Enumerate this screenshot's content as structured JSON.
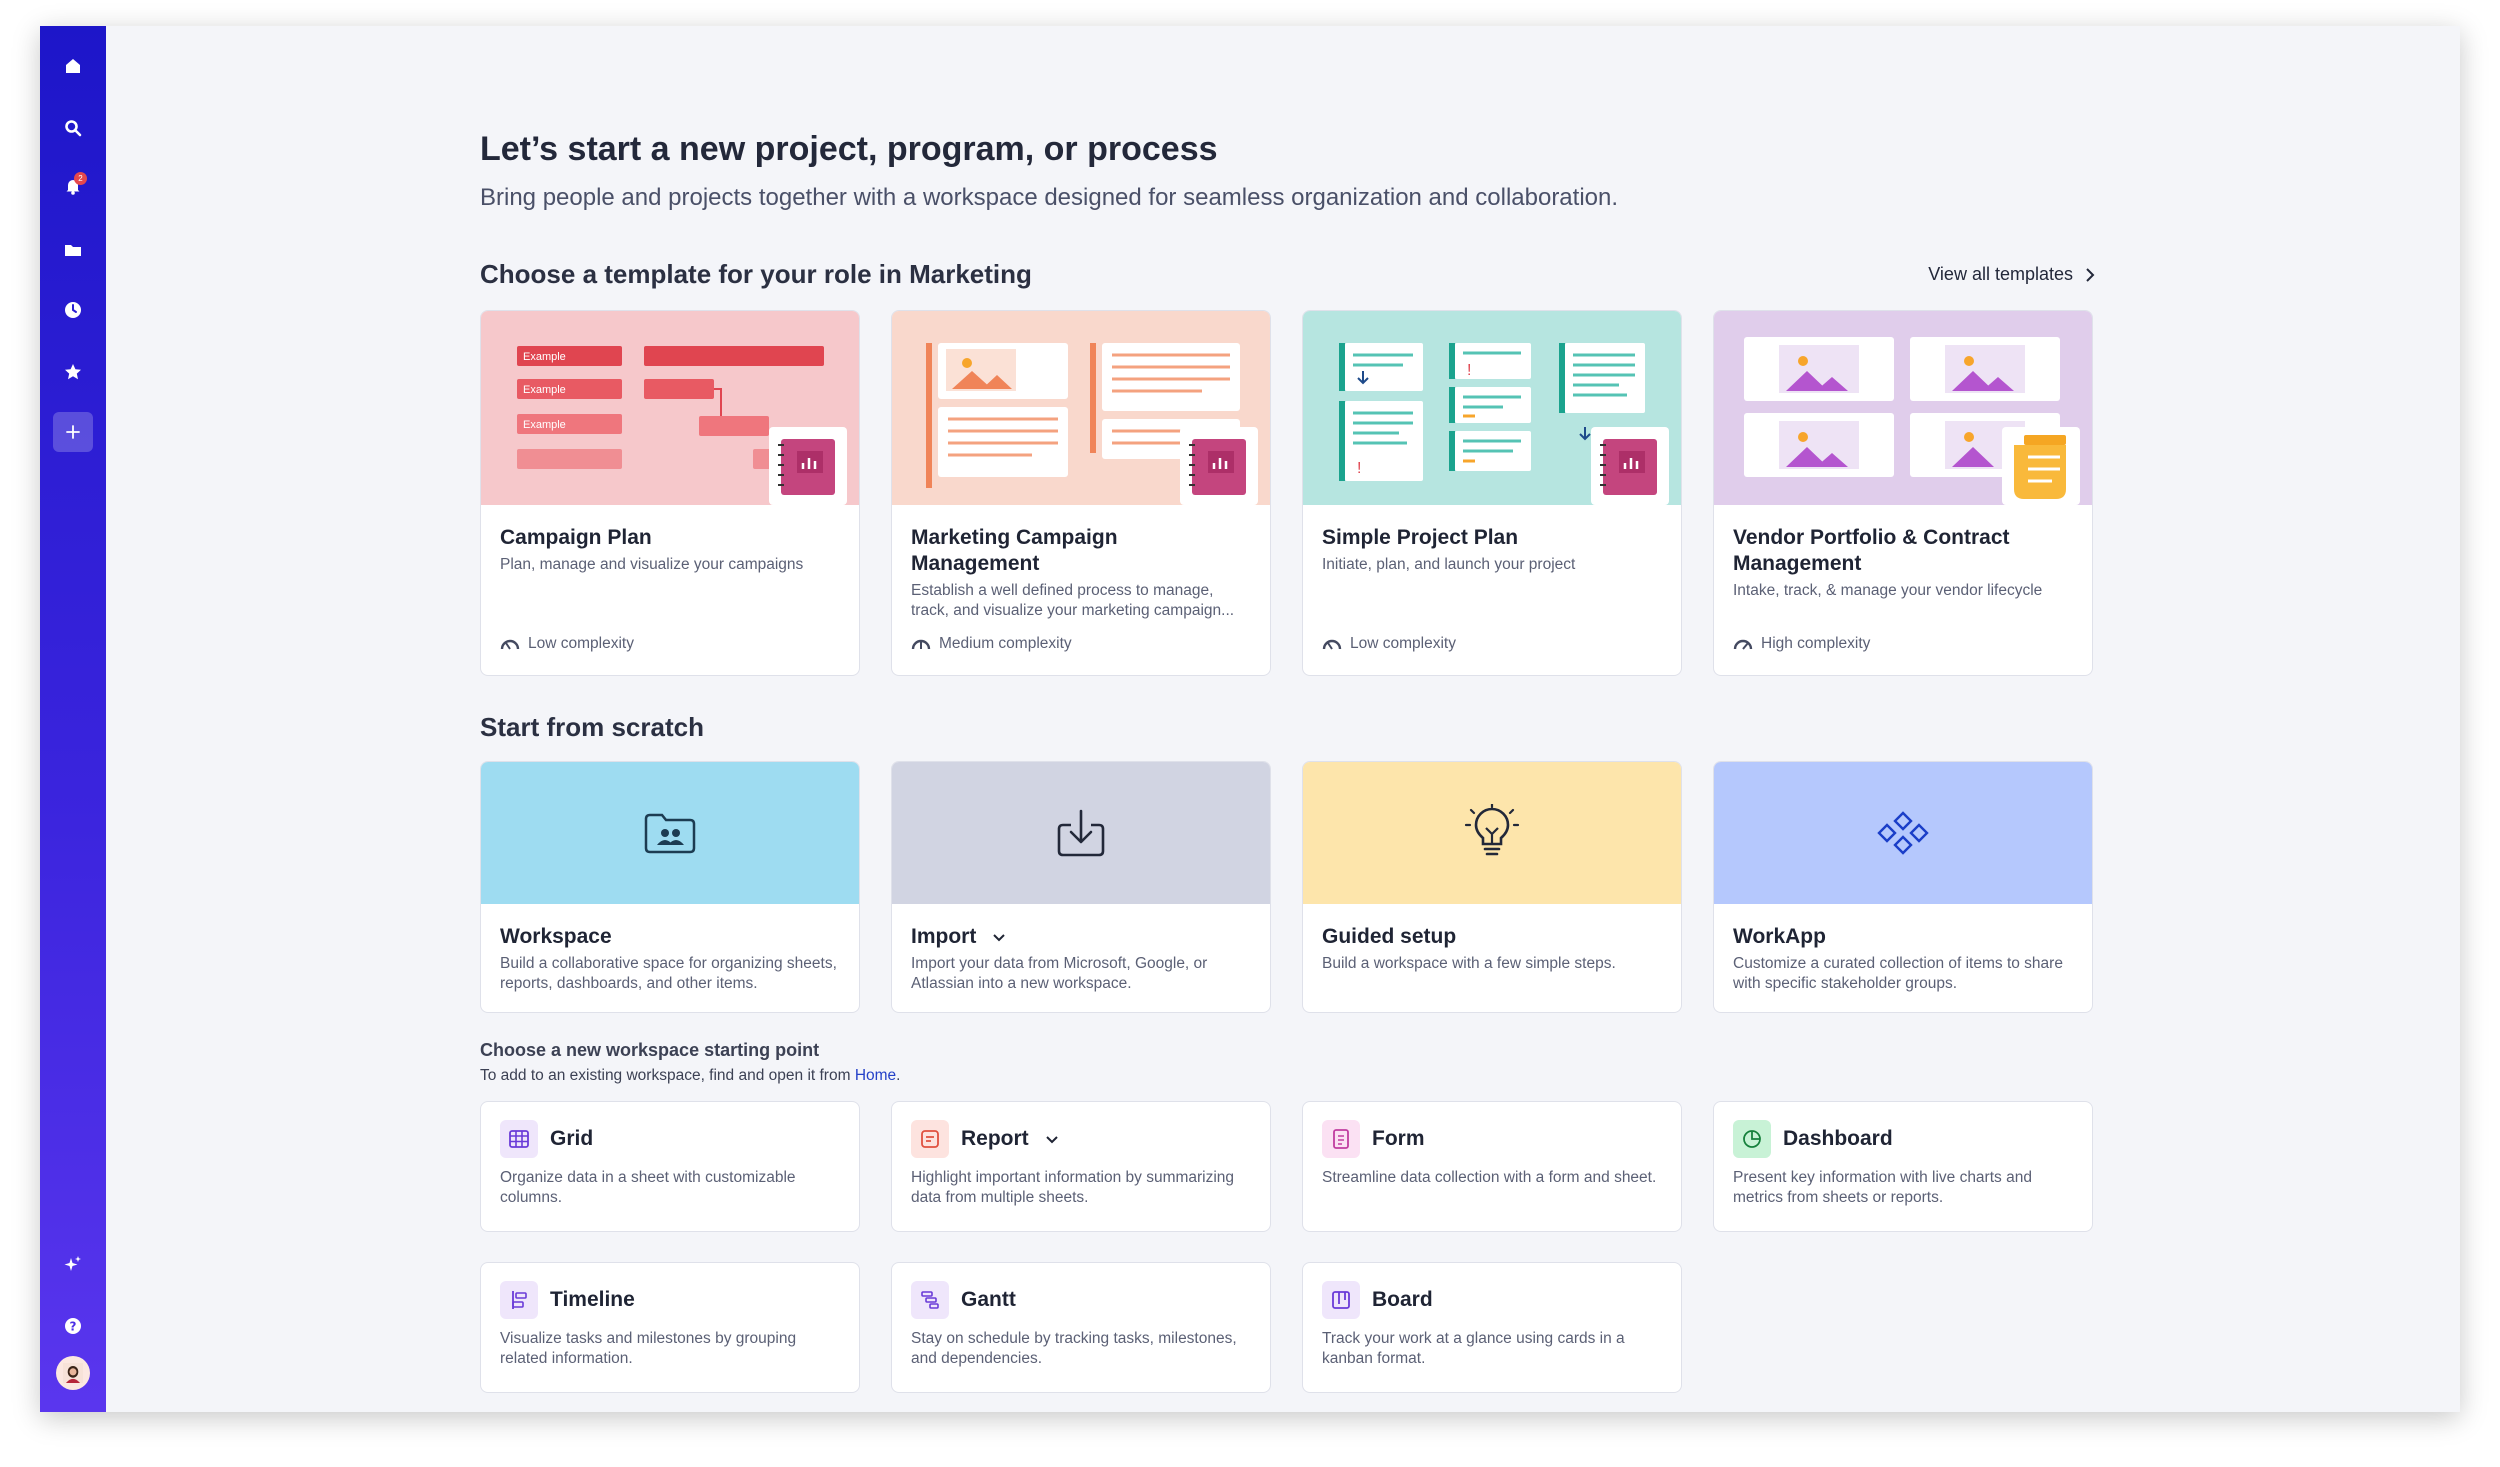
{
  "sidebar": {
    "icons": [
      "home-icon",
      "search-icon",
      "bell-icon",
      "folder-icon",
      "clock-icon",
      "star-icon",
      "plus-icon",
      "sparkle-icon",
      "help-icon",
      "avatar"
    ],
    "notification_count": "2"
  },
  "header": {
    "title": "Let’s start a new project, program, or process",
    "subtitle": "Bring people and projects together with a workspace designed for seamless organization and collaboration."
  },
  "templates": {
    "title": "Choose a template for your role in Marketing",
    "view_all": "View all templates",
    "example_label": "Example",
    "items": [
      {
        "title": "Campaign Plan",
        "desc": "Plan, manage and visualize your campaigns",
        "complexity": "Low complexity"
      },
      {
        "title": "Marketing Campaign Management",
        "desc": "Establish a well defined process to manage, track, and visualize your marketing campaign...",
        "complexity": "Medium complexity"
      },
      {
        "title": "Simple Project Plan",
        "desc": "Initiate, plan, and launch your project",
        "complexity": "Low complexity"
      },
      {
        "title": "Vendor Portfolio & Contract Management",
        "desc": "Intake, track, & manage your vendor lifecycle",
        "complexity": "High complexity"
      }
    ]
  },
  "scratch": {
    "title": "Start from scratch",
    "items": [
      {
        "title": "Workspace",
        "desc": "Build a collaborative space for organizing sheets, reports, dashboards, and other items."
      },
      {
        "title": "Import",
        "desc": "Import your data from Microsoft, Google, or Atlassian into a new workspace."
      },
      {
        "title": "Guided setup",
        "desc": "Build a workspace with a few simple steps."
      },
      {
        "title": "WorkApp",
        "desc": "Customize a curated collection of items to share with specific stakeholder groups."
      }
    ]
  },
  "starting_point": {
    "title": "Choose a new workspace starting point",
    "subtitle_prefix": "To add to an existing workspace, find and open it from ",
    "subtitle_link": "Home",
    "subtitle_suffix": ".",
    "items": [
      {
        "title": "Grid",
        "desc": "Organize data in a sheet with customizable columns."
      },
      {
        "title": "Report",
        "desc": "Highlight important information by summarizing data from multiple sheets."
      },
      {
        "title": "Form",
        "desc": "Streamline data collection with a form and sheet."
      },
      {
        "title": "Dashboard",
        "desc": "Present key information with live charts and metrics from sheets or reports."
      },
      {
        "title": "Timeline",
        "desc": "Visualize tasks and milestones by grouping related information."
      },
      {
        "title": "Gantt",
        "desc": "Stay on schedule by tracking tasks, milestones, and dependencies."
      },
      {
        "title": "Board",
        "desc": "Track your work at a glance using cards in a kanban format."
      }
    ]
  },
  "colors": {
    "sidebar_top": "#1d16c9",
    "sidebar_bottom": "#5a36ee",
    "workspace_bg": "#9edcf1",
    "import_bg": "#d1d4e2",
    "guided_bg": "#fde5ab",
    "workapp_bg": "#b5c8fd",
    "link": "#2441c8"
  }
}
